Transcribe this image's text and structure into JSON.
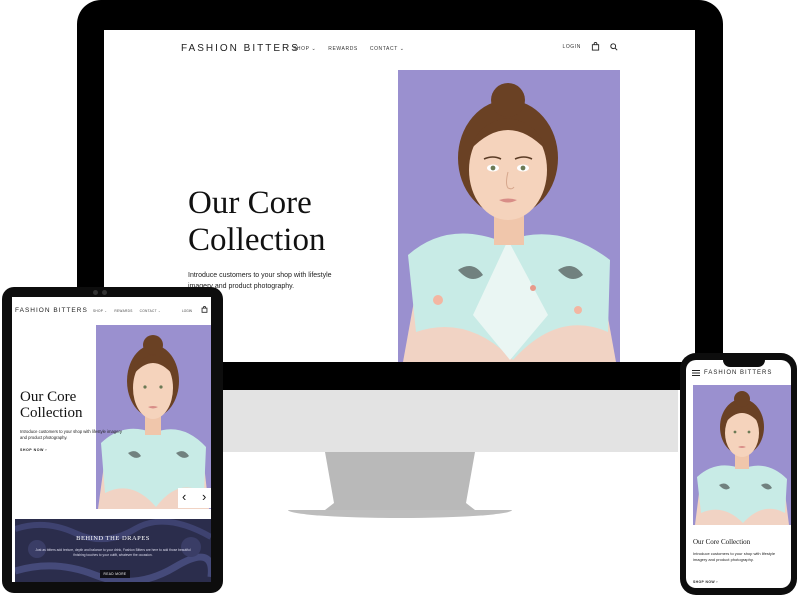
{
  "desktop": {
    "brand": "FASHION BITTERS",
    "nav": [
      "SHOP",
      "REWARDS",
      "CONTACT"
    ],
    "login": "LOGIN",
    "hero_title_line1": "Our Core",
    "hero_title_line2": "Collection",
    "hero_description": "Introduce customers to your shop with lifestyle imagery and product photography."
  },
  "tablet": {
    "brand": "FASHION BITTERS",
    "nav": [
      "SHOP",
      "REWARDS",
      "CONTACT"
    ],
    "login": "LOGIN",
    "hero_title_line1": "Our Core",
    "hero_title_line2": "Collection",
    "hero_description": "Introduce customers to your shop with lifestyle imagery and product photography.",
    "shop_now": "SHOP NOW",
    "banner_title": "BEHIND THE DRAPES",
    "banner_text": "Just as bitters add texture, depth and balance to your drink, Fashion Bitters are here to add those beautiful finishing touches to your outfit, whatever the occasion.",
    "banner_button": "READ MORE"
  },
  "phone": {
    "brand": "FASHION BITTERS",
    "hero_title": "Our Core Collection",
    "hero_description": "Introduce customers to your shop with lifestyle imagery and product photography.",
    "shop_now": "SHOP NOW"
  },
  "colors": {
    "photo_background": "#9a90cf",
    "banner_background": "#2b2d4c",
    "device_frame": "#000000",
    "monitor_stand": "#b9b9b9"
  }
}
